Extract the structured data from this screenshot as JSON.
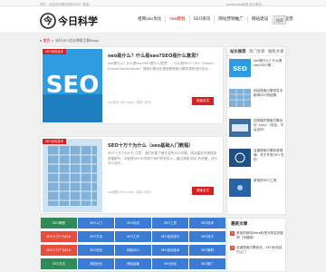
{
  "topbar": {
    "left_text": "您好，欢迎访问精仿赤旺SEO！登录",
    "right_text": "wordpress新浪  设为首页"
  },
  "logo": {
    "text": "今日科学"
  },
  "nav": {
    "items": [
      {
        "label": "祖网seo优化"
      },
      {
        "label": "seo教程"
      },
      {
        "label": "SEO资讯"
      },
      {
        "label": "网站营销推广"
      },
      {
        "label": "网站建设"
      },
      {
        "label": "网站运营"
      }
    ],
    "search_label": "搜索"
  },
  "breadcrumb": {
    "home": "首页",
    "rest": "赤旺SEO优化博客主题Blogs"
  },
  "cards": [
    {
      "tag": "SEO优化技术",
      "title": "seo是什么？什么是seo?SEO是什么意思？",
      "desc": "seo是什么？什么是seo?SEO是什么意思？... 什么是SEO? SEO（Search EngineOptimization）搜索引擎优化是按照搜索引擎的规则进行优化...",
      "meta": "seo技术   298 views   1周前   0评论",
      "more": "阅读全文"
    },
    {
      "tag": "SEO优化技术",
      "title": "SEO十万个为什么（seo基础入门教程）",
      "desc": "SEO十万个为什么 注意：我们所属了解无名的SEO问题。网站建设完美框架 修建细节，本就是SEO中的那个我们发布的人。通过调整 网站 的设置，进行SEO优化...",
      "meta": "seo教程   456 views   1周前   0评论",
      "more": "阅读全文"
    }
  ],
  "tags": [
    "SEO教程",
    "SEO入门",
    "SEO优化",
    "SEO工具",
    "SEO技术",
    "SEO十万个为什么",
    "SEO方法",
    "SEO工作",
    "SEO优化技巧",
    "SEO技巧",
    "SEO十万个为什么",
    "SEO优化",
    "网站SEO",
    "SEO优化技术",
    "SEO案例",
    "SEO方法",
    "网站优化",
    "网站运营",
    "SEO优化",
    "SEO推广"
  ],
  "sidebar": {
    "tabs": [
      "站长推荐",
      "热门文章",
      "随机文章"
    ],
    "articles": [
      {
        "title": "seo是什么？什么是seo?SEO是..."
      },
      {
        "title": "网站搜索引擎排名中影响SEO的因素"
      },
      {
        "title": "如何做好搜索引擎优化（seo）（排名、平台合作）"
      },
      {
        "title": "百度搜索引擎收录规律：关于开发SEO 在的"
      },
      {
        "title": "常用的SEO工具"
      }
    ],
    "latest_head": "最新文章",
    "latest": [
      {
        "num": "1",
        "title": "常用的网站Meta标签对排名的影响（详细版）"
      },
      {
        "num": "2",
        "title": "百度搜索引擎优化，SEO优化技巧入门"
      }
    ]
  }
}
